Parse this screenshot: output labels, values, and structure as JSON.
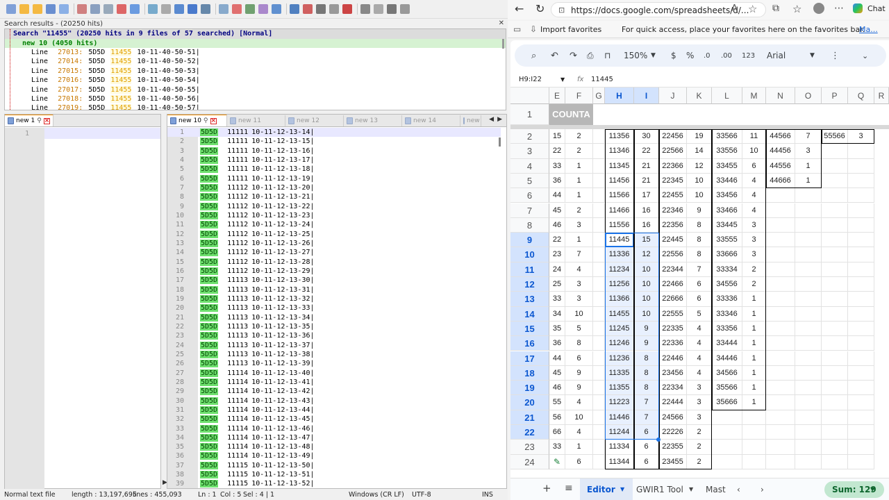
{
  "npp": {
    "search_title": "Search results - (20250 hits)",
    "search_header": "Search \"11455\" (20250 hits in 9 files of 57 searched) [Normal]",
    "search_file": "new 10 (4050 hits)",
    "search_lines": [
      {
        "label": "Line",
        "num": "27013:",
        "code": "5D5D",
        "hit": "11455",
        "tail": "10-11-40-50-51|"
      },
      {
        "label": "Line",
        "num": "27014:",
        "code": "5D5D",
        "hit": "11455",
        "tail": "10-11-40-50-52|"
      },
      {
        "label": "Line",
        "num": "27015:",
        "code": "5D5D",
        "hit": "11455",
        "tail": "10-11-40-50-53|"
      },
      {
        "label": "Line",
        "num": "27016:",
        "code": "5D5D",
        "hit": "11455",
        "tail": "10-11-40-50-54|"
      },
      {
        "label": "Line",
        "num": "27017:",
        "code": "5D5D",
        "hit": "11455",
        "tail": "10-11-40-50-55|"
      },
      {
        "label": "Line",
        "num": "27018:",
        "code": "5D5D",
        "hit": "11455",
        "tail": "10-11-40-50-56|"
      },
      {
        "label": "Line",
        "num": "27019:",
        "code": "5D5D",
        "hit": "11455",
        "tail": "10-11-40-50-57|"
      }
    ],
    "left_tab": "new 1",
    "left_line": "1",
    "right_tabs": [
      "new 10",
      "new 11",
      "new 12",
      "new 13",
      "new 14",
      "new"
    ],
    "code_lines": [
      {
        "n": "1",
        "k": "5D5D",
        "a": "11111",
        "b": "10-11-12-13-14|"
      },
      {
        "n": "2",
        "k": "5D5D",
        "a": "11111",
        "b": "10-11-12-13-15|"
      },
      {
        "n": "3",
        "k": "5D5D",
        "a": "11111",
        "b": "10-11-12-13-16|"
      },
      {
        "n": "4",
        "k": "5D5D",
        "a": "11111",
        "b": "10-11-12-13-17|"
      },
      {
        "n": "5",
        "k": "5D5D",
        "a": "11111",
        "b": "10-11-12-13-18|"
      },
      {
        "n": "6",
        "k": "5D5D",
        "a": "11111",
        "b": "10-11-12-13-19|"
      },
      {
        "n": "7",
        "k": "5D5D",
        "a": "11112",
        "b": "10-11-12-13-20|"
      },
      {
        "n": "8",
        "k": "5D5D",
        "a": "11112",
        "b": "10-11-12-13-21|"
      },
      {
        "n": "9",
        "k": "5D5D",
        "a": "11112",
        "b": "10-11-12-13-22|"
      },
      {
        "n": "10",
        "k": "5D5D",
        "a": "11112",
        "b": "10-11-12-13-23|"
      },
      {
        "n": "11",
        "k": "5D5D",
        "a": "11112",
        "b": "10-11-12-13-24|"
      },
      {
        "n": "12",
        "k": "5D5D",
        "a": "11112",
        "b": "10-11-12-13-25|"
      },
      {
        "n": "13",
        "k": "5D5D",
        "a": "11112",
        "b": "10-11-12-13-26|"
      },
      {
        "n": "14",
        "k": "5D5D",
        "a": "11112",
        "b": "10-11-12-13-27|"
      },
      {
        "n": "15",
        "k": "5D5D",
        "a": "11112",
        "b": "10-11-12-13-28|"
      },
      {
        "n": "16",
        "k": "5D5D",
        "a": "11112",
        "b": "10-11-12-13-29|"
      },
      {
        "n": "17",
        "k": "5D5D",
        "a": "11113",
        "b": "10-11-12-13-30|"
      },
      {
        "n": "18",
        "k": "5D5D",
        "a": "11113",
        "b": "10-11-12-13-31|"
      },
      {
        "n": "19",
        "k": "5D5D",
        "a": "11113",
        "b": "10-11-12-13-32|"
      },
      {
        "n": "20",
        "k": "5D5D",
        "a": "11113",
        "b": "10-11-12-13-33|"
      },
      {
        "n": "21",
        "k": "5D5D",
        "a": "11113",
        "b": "10-11-12-13-34|"
      },
      {
        "n": "22",
        "k": "5D5D",
        "a": "11113",
        "b": "10-11-12-13-35|"
      },
      {
        "n": "23",
        "k": "5D5D",
        "a": "11113",
        "b": "10-11-12-13-36|"
      },
      {
        "n": "24",
        "k": "5D5D",
        "a": "11113",
        "b": "10-11-12-13-37|"
      },
      {
        "n": "25",
        "k": "5D5D",
        "a": "11113",
        "b": "10-11-12-13-38|"
      },
      {
        "n": "26",
        "k": "5D5D",
        "a": "11113",
        "b": "10-11-12-13-39|"
      },
      {
        "n": "27",
        "k": "5D5D",
        "a": "11114",
        "b": "10-11-12-13-40|"
      },
      {
        "n": "28",
        "k": "5D5D",
        "a": "11114",
        "b": "10-11-12-13-41|"
      },
      {
        "n": "29",
        "k": "5D5D",
        "a": "11114",
        "b": "10-11-12-13-42|"
      },
      {
        "n": "30",
        "k": "5D5D",
        "a": "11114",
        "b": "10-11-12-13-43|"
      },
      {
        "n": "31",
        "k": "5D5D",
        "a": "11114",
        "b": "10-11-12-13-44|"
      },
      {
        "n": "32",
        "k": "5D5D",
        "a": "11114",
        "b": "10-11-12-13-45|"
      },
      {
        "n": "33",
        "k": "5D5D",
        "a": "11114",
        "b": "10-11-12-13-46|"
      },
      {
        "n": "34",
        "k": "5D5D",
        "a": "11114",
        "b": "10-11-12-13-47|"
      },
      {
        "n": "35",
        "k": "5D5D",
        "a": "11114",
        "b": "10-11-12-13-48|"
      },
      {
        "n": "36",
        "k": "5D5D",
        "a": "11114",
        "b": "10-11-12-13-49|"
      },
      {
        "n": "37",
        "k": "5D5D",
        "a": "11115",
        "b": "10-11-12-13-50|"
      },
      {
        "n": "38",
        "k": "5D5D",
        "a": "11115",
        "b": "10-11-12-13-51|"
      },
      {
        "n": "39",
        "k": "5D5D",
        "a": "11115",
        "b": "10-11-12-13-52|"
      }
    ],
    "status": {
      "type": "Normal text file",
      "length": "length : 13,197,695",
      "lines": "lines : 455,093",
      "ln": "Ln : 1",
      "col": "Col : 5",
      "sel": "Sel : 4 | 1",
      "eol": "Windows (CR LF)",
      "enc": "UTF-8",
      "mode": "INS"
    }
  },
  "edge": {
    "url": "https://docs.google.com/spreadsheets/d/...",
    "chat_label": "Chat",
    "import_favorites": "Import favorites",
    "fav_hint": "For quick access, place your favorites here on the favorites bar.",
    "fav_link": "Ma..."
  },
  "sheets": {
    "zoom": "150%",
    "currency": "$",
    "percent": "%",
    "dec_less": ".0",
    "dec_more": ".00",
    "num_format": "123",
    "font": "Arial",
    "name_box": "H9:I22",
    "fx": "fx",
    "formula": "11445",
    "col_headers": [
      "E",
      "F",
      "G",
      "H",
      "I",
      "J",
      "K",
      "L",
      "M",
      "N",
      "O",
      "P",
      "Q",
      "R"
    ],
    "header_cell": "COUNTA",
    "rows": [
      {
        "r": "2",
        "c": [
          "15",
          "2",
          "",
          "11356",
          "30",
          "22456",
          "19",
          "33566",
          "11",
          "44566",
          "7",
          "55566",
          "3"
        ]
      },
      {
        "r": "3",
        "c": [
          "22",
          "2",
          "",
          "11346",
          "22",
          "22566",
          "14",
          "33556",
          "10",
          "44456",
          "3",
          "",
          ""
        ]
      },
      {
        "r": "4",
        "c": [
          "33",
          "1",
          "",
          "11345",
          "21",
          "22366",
          "12",
          "33455",
          "6",
          "44556",
          "1",
          "",
          ""
        ]
      },
      {
        "r": "5",
        "c": [
          "36",
          "1",
          "",
          "11456",
          "21",
          "22345",
          "10",
          "33446",
          "4",
          "44666",
          "1",
          "",
          ""
        ]
      },
      {
        "r": "6",
        "c": [
          "44",
          "1",
          "",
          "11566",
          "17",
          "22455",
          "10",
          "33456",
          "4",
          "",
          "",
          "",
          ""
        ]
      },
      {
        "r": "7",
        "c": [
          "45",
          "2",
          "",
          "11466",
          "16",
          "22346",
          "9",
          "33466",
          "4",
          "",
          "",
          "",
          ""
        ]
      },
      {
        "r": "8",
        "c": [
          "46",
          "3",
          "",
          "11556",
          "16",
          "22356",
          "8",
          "33445",
          "3",
          "",
          "",
          "",
          ""
        ]
      },
      {
        "r": "9",
        "c": [
          "22",
          "1",
          "",
          "11445",
          "15",
          "22445",
          "8",
          "33555",
          "3",
          "",
          "",
          "",
          ""
        ]
      },
      {
        "r": "10",
        "c": [
          "23",
          "7",
          "",
          "11336",
          "12",
          "22556",
          "8",
          "33666",
          "3",
          "",
          "",
          "",
          ""
        ]
      },
      {
        "r": "11",
        "c": [
          "24",
          "4",
          "",
          "11234",
          "10",
          "22344",
          "7",
          "33334",
          "2",
          "",
          "",
          "",
          ""
        ]
      },
      {
        "r": "12",
        "c": [
          "25",
          "3",
          "",
          "11256",
          "10",
          "22466",
          "6",
          "34556",
          "2",
          "",
          "",
          "",
          ""
        ]
      },
      {
        "r": "13",
        "c": [
          "33",
          "3",
          "",
          "11366",
          "10",
          "22666",
          "6",
          "33336",
          "1",
          "",
          "",
          "",
          ""
        ]
      },
      {
        "r": "14",
        "c": [
          "34",
          "10",
          "",
          "11455",
          "10",
          "22555",
          "5",
          "33346",
          "1",
          "",
          "",
          "",
          ""
        ]
      },
      {
        "r": "15",
        "c": [
          "35",
          "5",
          "",
          "11245",
          "9",
          "22335",
          "4",
          "33356",
          "1",
          "",
          "",
          "",
          ""
        ]
      },
      {
        "r": "16",
        "c": [
          "36",
          "8",
          "",
          "11246",
          "9",
          "22336",
          "4",
          "33444",
          "1",
          "",
          "",
          "",
          ""
        ]
      },
      {
        "r": "17",
        "c": [
          "44",
          "6",
          "",
          "11236",
          "8",
          "22446",
          "4",
          "34446",
          "1",
          "",
          "",
          "",
          ""
        ]
      },
      {
        "r": "18",
        "c": [
          "45",
          "9",
          "",
          "11335",
          "8",
          "23456",
          "4",
          "34566",
          "1",
          "",
          "",
          "",
          ""
        ]
      },
      {
        "r": "19",
        "c": [
          "46",
          "9",
          "",
          "11355",
          "8",
          "22334",
          "3",
          "35566",
          "1",
          "",
          "",
          "",
          ""
        ]
      },
      {
        "r": "20",
        "c": [
          "55",
          "4",
          "",
          "11223",
          "7",
          "22444",
          "3",
          "35666",
          "1",
          "",
          "",
          "",
          ""
        ]
      },
      {
        "r": "21",
        "c": [
          "56",
          "10",
          "",
          "11446",
          "7",
          "24566",
          "3",
          "",
          "",
          "",
          "",
          "",
          ""
        ]
      },
      {
        "r": "22",
        "c": [
          "66",
          "4",
          "",
          "11244",
          "6",
          "22226",
          "2",
          "",
          "",
          "",
          "",
          "",
          ""
        ]
      },
      {
        "r": "23",
        "c": [
          "33",
          "1",
          "",
          "11334",
          "6",
          "22355",
          "2",
          "",
          "",
          "",
          "",
          "",
          ""
        ]
      },
      {
        "r": "24",
        "c": [
          "",
          "6",
          "",
          "11344",
          "6",
          "23455",
          "2",
          "",
          "",
          "",
          "",
          "",
          ""
        ]
      }
    ],
    "row1": "1",
    "tabs": {
      "active": "Editor",
      "t2": "GWIR1 Tool",
      "t3": "Mast"
    },
    "sum": "Sum: 129"
  }
}
